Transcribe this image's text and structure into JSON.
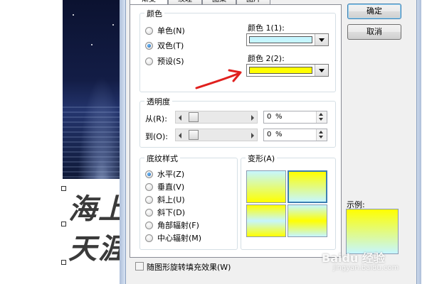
{
  "tabs": [
    "渐变",
    "纹理",
    "图案",
    "图片"
  ],
  "colors_group": {
    "legend": "颜色",
    "options": [
      {
        "label": "单色(N)",
        "checked": false
      },
      {
        "label": "双色(T)",
        "checked": true
      },
      {
        "label": "预设(S)",
        "checked": false
      }
    ],
    "color1_label": "颜色 1(1):",
    "color1_value": "#c6f6ff",
    "color2_label": "颜色 2(2):",
    "color2_value": "#ffff00"
  },
  "transparency": {
    "legend": "透明度",
    "from_label": "从(R):",
    "from_value": "0",
    "to_label": "到(O):",
    "to_value": "0",
    "unit": "%"
  },
  "shading_styles": {
    "legend": "底纹样式",
    "options": [
      {
        "label": "水平(Z)",
        "checked": true
      },
      {
        "label": "垂直(V)",
        "checked": false
      },
      {
        "label": "斜上(U)",
        "checked": false
      },
      {
        "label": "斜下(D)",
        "checked": false
      },
      {
        "label": "角部辐射(F)",
        "checked": false
      },
      {
        "label": "中心辐射(M)",
        "checked": false
      }
    ]
  },
  "variants": {
    "legend": "变形(A)",
    "selected_index": 1
  },
  "sample_label": "示例:",
  "rotate_checkbox": {
    "label": "随图形旋转填充效果(W)",
    "checked": false
  },
  "buttons": {
    "ok": "确定",
    "cancel": "取消"
  },
  "background_text": {
    "line1": "海上",
    "line2": "天涯"
  },
  "watermark": {
    "brand": "Baidu 经验",
    "url": "jingyan.baidu.com"
  },
  "annotation_color": "#e0201e"
}
